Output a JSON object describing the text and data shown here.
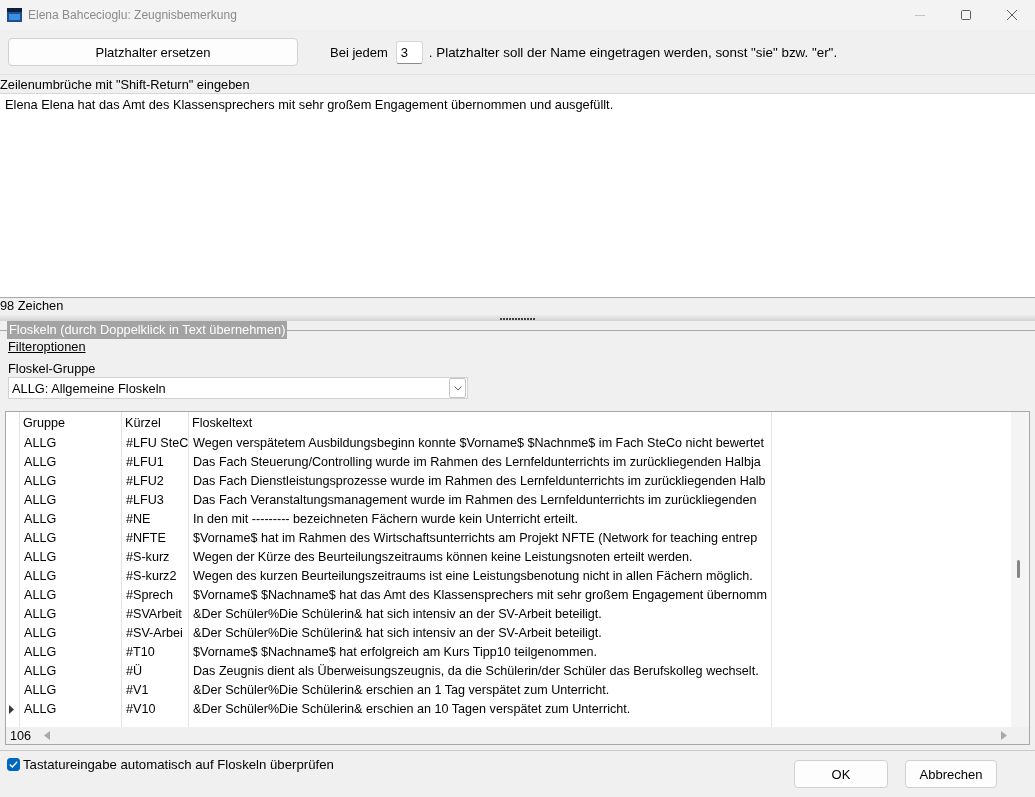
{
  "window": {
    "title": "Elena Bahcecioglu: Zeugnisbemerkung",
    "controls": [
      {
        "kind": "minimize",
        "disabled": true
      },
      {
        "kind": "maximize",
        "disabled": false
      },
      {
        "kind": "close",
        "disabled": false
      }
    ]
  },
  "toolbar": {
    "replace_button": "Platzhalter ersetzen",
    "prefix": "Bei jedem",
    "interval_value": "3",
    "suffix": ". Platzhalter soll der Name eingetragen werden, sonst \"sie\" bzw. \"er\"."
  },
  "editor": {
    "hint": "Zeilenumbrüche mit \"Shift-Return\" eingeben",
    "value": "Elena Elena hat das Amt des Klassensprechers mit sehr großem Engagement übernommen und ausgefüllt.",
    "char_count": "98 Zeichen"
  },
  "phrases": {
    "title": "Floskeln (durch Doppelklick in Text übernehmen)",
    "focused": true,
    "filter_link": "Filteroptionen",
    "group_label": "Floskel-Gruppe",
    "group_value": "ALLG: Allgemeine Floskeln",
    "table": {
      "columns": [
        "Gruppe",
        "Kürzel",
        "Floskeltext"
      ],
      "rows": [
        {
          "cells": [
            "ALLG",
            "#LFU SteC",
            "Wegen verspätetem Ausbildungsbeginn konnte $Vorname$ $Nachnme$ im Fach SteCo nicht bewertet"
          ],
          "selected": false
        },
        {
          "cells": [
            "ALLG",
            "#LFU1",
            "Das Fach Steuerung/Controlling wurde im Rahmen des Lernfeldunterrichts im zurückliegenden Halbja"
          ],
          "selected": false
        },
        {
          "cells": [
            "ALLG",
            "#LFU2",
            "Das Fach Dienstleistungsprozesse wurde im Rahmen des Lernfeldunterrichts im zurückliegenden Halb"
          ],
          "selected": false
        },
        {
          "cells": [
            "ALLG",
            "#LFU3",
            "Das Fach Veranstaltungsmanagement wurde im Rahmen des Lernfeldunterrichts im zurückliegenden"
          ],
          "selected": false
        },
        {
          "cells": [
            "ALLG",
            "#NE",
            "In den mit --------- bezeichneten Fächern wurde kein Unterricht erteilt."
          ],
          "selected": false
        },
        {
          "cells": [
            "ALLG",
            "#NFTE",
            "$Vorname$ hat im Rahmen des Wirtschaftsunterrichts am Projekt NFTE (Network for teaching entrep"
          ],
          "selected": false
        },
        {
          "cells": [
            "ALLG",
            "#S-kurz",
            "Wegen der Kürze des Beurteilungszeitraums können keine Leistungsnoten erteilt werden."
          ],
          "selected": false
        },
        {
          "cells": [
            "ALLG",
            "#S-kurz2",
            "Wegen des kurzen Beurteilungszeitraums ist eine Leistungsbenotung nicht in allen Fächern möglich."
          ],
          "selected": false
        },
        {
          "cells": [
            "ALLG",
            "#Sprech",
            "$Vorname$ $Nachname$ hat das Amt des Klassensprechers mit sehr großem Engagement übernomm"
          ],
          "selected": false
        },
        {
          "cells": [
            "ALLG",
            "#SVArbeit",
            "&Der Schüler%Die Schülerin& hat sich intensiv an der SV-Arbeit beteiligt."
          ],
          "selected": false
        },
        {
          "cells": [
            "ALLG",
            "#SV-Arbei",
            "&Der Schüler%Die Schülerin& hat sich intensiv an der SV-Arbeit beteiligt."
          ],
          "selected": false
        },
        {
          "cells": [
            "ALLG",
            "#T10",
            "$Vorname$ $Nachname$ hat erfolgreich am Kurs Tipp10 teilgenommen."
          ],
          "selected": false
        },
        {
          "cells": [
            "ALLG",
            "#Ü",
            "Das Zeugnis dient als Überweisungszeugnis, da die Schülerin/der Schüler das Berufskolleg wechselt."
          ],
          "selected": false
        },
        {
          "cells": [
            "ALLG",
            "#V1",
            "&Der Schüler%Die Schülerin& erschien an 1 Tag verspätet zum Unterricht."
          ],
          "selected": false
        },
        {
          "cells": [
            "ALLG",
            "#V10",
            "&Der Schüler%Die Schülerin& erschien an 10 Tagen verspätet zum Unterricht."
          ],
          "selected": true
        }
      ],
      "row_count": "106"
    }
  },
  "auto_check": {
    "label": "Tastatureingabe automatisch auf Floskeln überprüfen",
    "checked": true
  },
  "buttons": [
    "OK",
    "Abbrechen"
  ]
}
